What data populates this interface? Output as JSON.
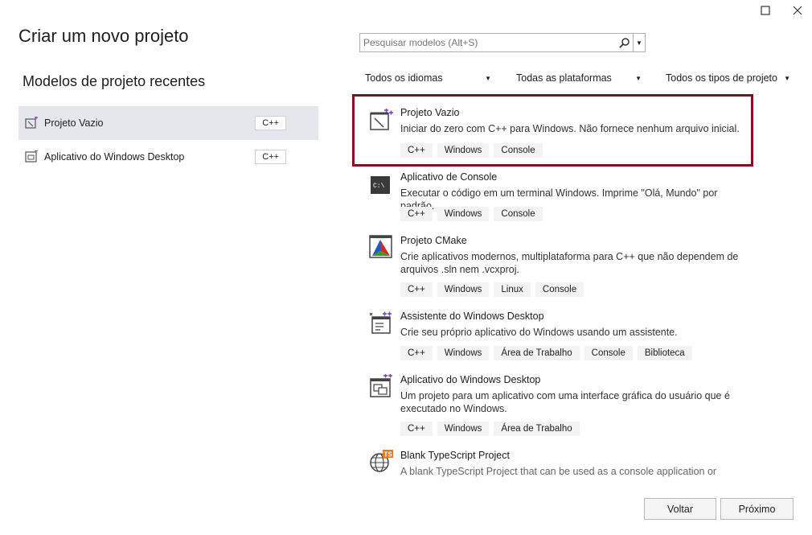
{
  "window": {
    "maximize_icon": "maximize-icon",
    "close_icon": "close-icon"
  },
  "header": {
    "title": "Criar um novo projeto",
    "recent_title": "Modelos de projeto recentes"
  },
  "recent": [
    {
      "label": "Projeto Vazio",
      "tag": "C++",
      "selected": true
    },
    {
      "label": "Aplicativo do Windows Desktop",
      "tag": "C++",
      "selected": false
    }
  ],
  "search": {
    "placeholder": "Pesquisar modelos (Alt+S)",
    "value": ""
  },
  "filters": [
    {
      "label": "Todos os idiomas"
    },
    {
      "label": "Todas as plataformas"
    },
    {
      "label": "Todos os tipos de projeto"
    }
  ],
  "templates": [
    {
      "name": "Projeto Vazio",
      "desc": "Iniciar do zero com C++ para Windows. Não fornece nenhum arquivo inicial.",
      "tags": [
        "C++",
        "Windows",
        "Console"
      ],
      "selected": true
    },
    {
      "name": "Aplicativo de Console",
      "desc": "Executar o código em um terminal Windows. Imprime \"Olá, Mundo\" por padrão.",
      "tags": [
        "C++",
        "Windows",
        "Console"
      ]
    },
    {
      "name": "Projeto CMake",
      "desc": "Crie aplicativos modernos, multiplataforma para C++ que não dependem de arquivos .sln nem .vcxproj.",
      "tags": [
        "C++",
        "Windows",
        "Linux",
        "Console"
      ]
    },
    {
      "name": "Assistente do Windows Desktop",
      "desc": "Crie seu próprio aplicativo do Windows usando um assistente.",
      "tags": [
        "C++",
        "Windows",
        "Área de Trabalho",
        "Console",
        "Biblioteca"
      ]
    },
    {
      "name": "Aplicativo do Windows Desktop",
      "desc": "Um projeto para um aplicativo com uma interface gráfica do usuário que é executado no Windows.",
      "tags": [
        "C++",
        "Windows",
        "Área de Trabalho"
      ]
    },
    {
      "name": "Blank TypeScript Project",
      "desc": "A blank TypeScript Project that can be used as a console application or library."
    }
  ],
  "footer": {
    "back_label": "Voltar",
    "next_label": "Próximo"
  },
  "colors": {
    "selection_border": "#7a1424",
    "recent_selected_bg": "#e6e7ed"
  }
}
